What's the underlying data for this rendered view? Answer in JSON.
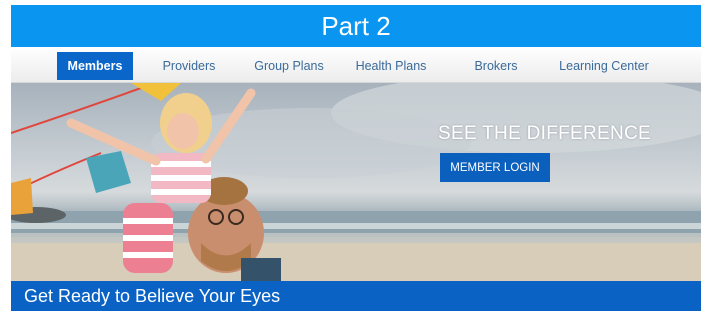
{
  "header": {
    "title": "Part 2",
    "color": "#0a96f0"
  },
  "nav": {
    "items": [
      {
        "label": "Members",
        "active": true
      },
      {
        "label": "Providers",
        "active": false
      },
      {
        "label": "Group Plans",
        "active": false
      },
      {
        "label": "Health Plans",
        "active": false
      },
      {
        "label": "Brokers",
        "active": false
      },
      {
        "label": "Learning Center",
        "active": false
      }
    ],
    "active_color": "#0b66c9"
  },
  "hero": {
    "heading": "SEE THE DIFFERENCE",
    "button_label": "MEMBER LOGIN",
    "image_subject": "father-carrying-daughter-on-beach"
  },
  "tagline": {
    "text": "Get Ready to Believe Your Eyes",
    "color": "#0a63c4"
  }
}
